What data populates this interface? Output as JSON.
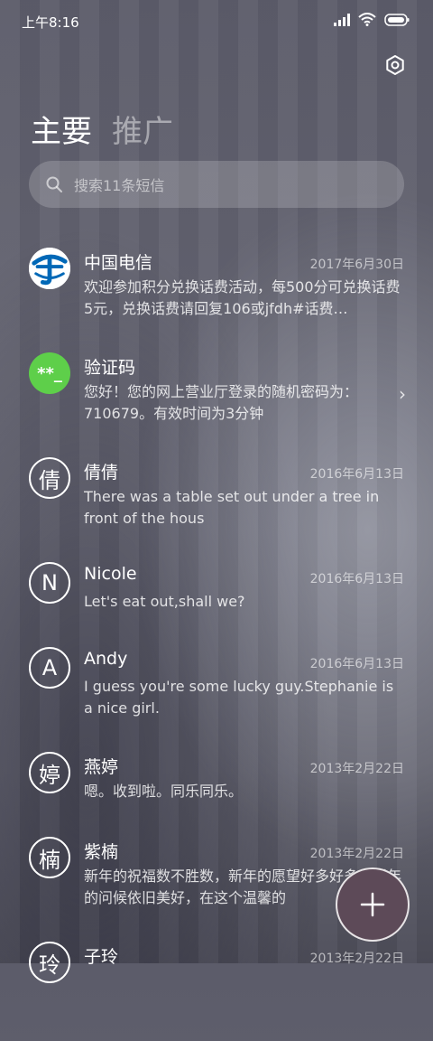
{
  "status_bar": {
    "time": "上午8:16"
  },
  "tabs": [
    {
      "label": "主要"
    },
    {
      "label": "推广"
    }
  ],
  "search": {
    "placeholder": "搜索11条短信"
  },
  "conversations": [
    {
      "name": "中国电信",
      "date": "2017年6月30日",
      "preview": "欢迎参加积分兑换话费活动，每500分可兑换话费5元，兑换话费请回复106或jfdh#话费…",
      "avatar": "telecom-logo"
    },
    {
      "name": "验证码",
      "date": "",
      "preview": "您好！您的网上营业厅登录的随机密码为：710679。有效时间为3分钟",
      "avatar": "**_"
    },
    {
      "name": "倩倩",
      "date": "2016年6月13日",
      "preview": "There was a table set out under a tree in front of the hous",
      "avatar": "倩"
    },
    {
      "name": "Nicole",
      "date": "2016年6月13日",
      "preview": "Let's eat out,shall we?",
      "avatar": "N"
    },
    {
      "name": "Andy",
      "date": "2016年6月13日",
      "preview": "I guess you're some lucky guy.Stephanie is a nice girl.",
      "avatar": "A"
    },
    {
      "name": "燕婷",
      "date": "2013年2月22日",
      "preview": "嗯。收到啦。同乐同乐。",
      "avatar": "婷"
    },
    {
      "name": "紫楠",
      "date": "2013年2月22日",
      "preview": "新年的祝福数不胜数，新年的愿望好多好多，新年的问候依旧美好，在这个温馨的",
      "avatar": "楠"
    },
    {
      "name": "子玲",
      "date": "2013年2月22日",
      "preview": "",
      "avatar": "玲"
    }
  ],
  "colors": {
    "avatar_green": "#5ecf4a",
    "fab": "#5d4a58"
  }
}
